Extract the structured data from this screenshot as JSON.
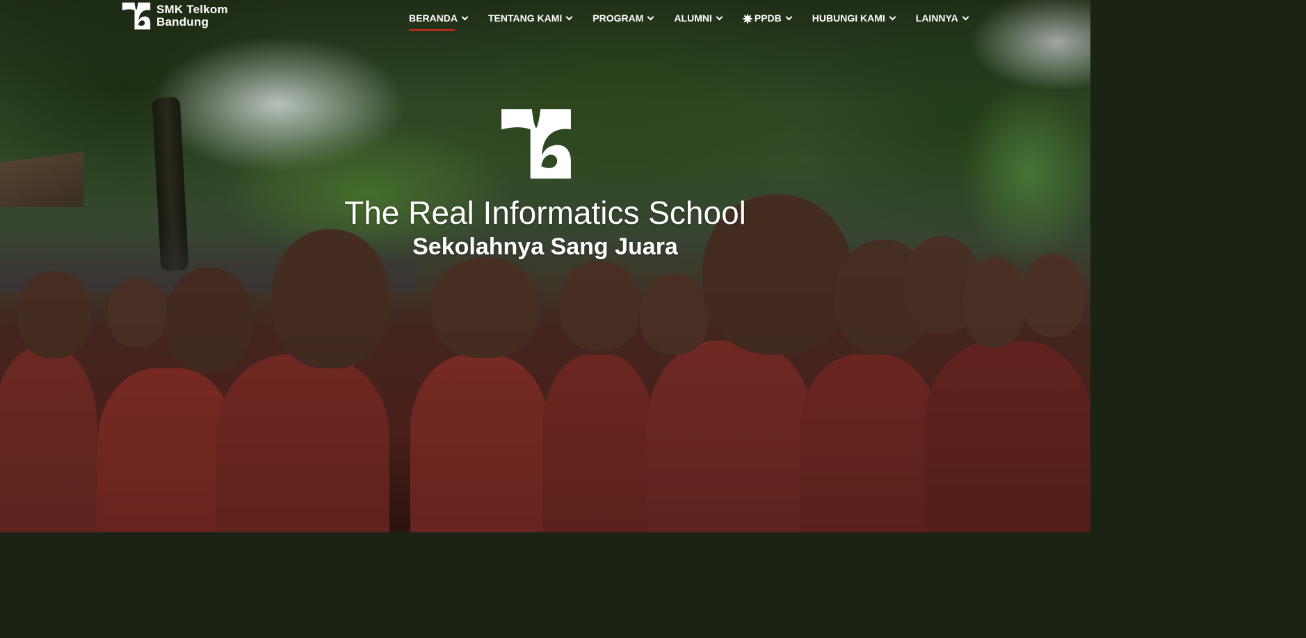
{
  "header": {
    "logo_line1": "SMK Telkom",
    "logo_line2": "Bandung"
  },
  "nav": {
    "items": [
      {
        "label": "BERANDA",
        "icon": "chevron-down-icon"
      },
      {
        "label": "TENTANG KAMI",
        "icon": "chevron-down-icon"
      },
      {
        "label": "PROGRAM",
        "icon": "chevron-down-icon"
      },
      {
        "label": "ALUMNI",
        "icon": "chevron-down-icon"
      },
      {
        "label": "PPDB",
        "icon": "gear-icon"
      },
      {
        "label": "HUBUNGI KAMI",
        "icon": "chevron-down-icon"
      },
      {
        "label": "LAINNYA",
        "icon": "chevron-down-icon"
      }
    ],
    "active_index": 0
  },
  "hero": {
    "title": "The Real Informatics School",
    "subtitle": "Sekolahnya Sang Juara"
  },
  "colors": {
    "accent": "#e0261b",
    "text": "#ffffff",
    "uniform": "#7c2f28"
  }
}
